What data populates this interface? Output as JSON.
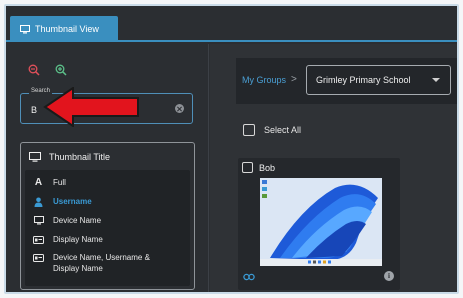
{
  "tab": {
    "label": "Thumbnail View",
    "icon": "monitor-icon",
    "accent": "#3a8fbf"
  },
  "zoom": {
    "out_icon": "zoom-out-icon",
    "in_icon": "zoom-in-icon",
    "color": "#e0505a",
    "in_color": "#5cc08a"
  },
  "search": {
    "legend": "Search",
    "value": "B",
    "placeholder": ""
  },
  "annotation": {
    "arrow_color": "#e2141d"
  },
  "thumbnail_title": {
    "heading": "Thumbnail Title",
    "options": [
      {
        "label": "Full",
        "icon": "letter-a-icon",
        "selected": false
      },
      {
        "label": "Username",
        "icon": "user-icon",
        "selected": true
      },
      {
        "label": "Device Name",
        "icon": "monitor-icon",
        "selected": false
      },
      {
        "label": "Display Name",
        "icon": "id-card-icon",
        "selected": false
      },
      {
        "label": "Device Name, Username & Display Name",
        "icon": "id-card-icon",
        "selected": false
      }
    ]
  },
  "groups": {
    "crumb": "My Groups",
    "separator": ">",
    "selected_group": "Grimley Primary School"
  },
  "select_all": {
    "label": "Select All"
  },
  "cards": [
    {
      "name": "Bob",
      "footer_icon": "link-icon",
      "info_icon": "info-icon",
      "info_text": "i"
    }
  ]
}
